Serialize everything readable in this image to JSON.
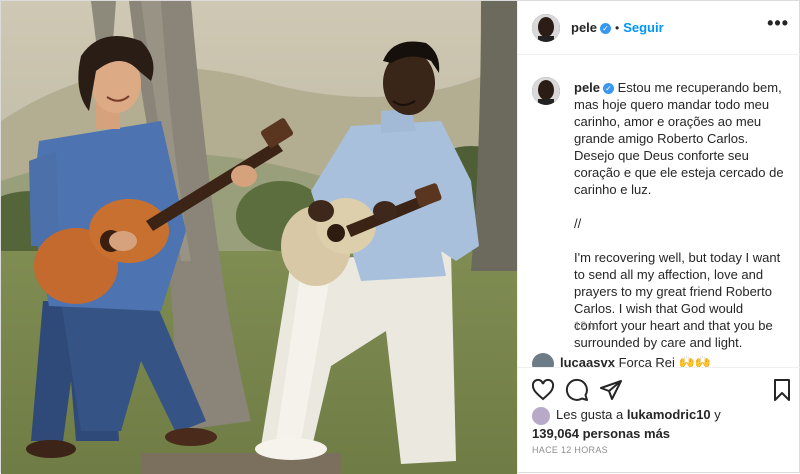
{
  "post": {
    "image_alt": "Pelé and Roberto Carlos playing guitars"
  },
  "header": {
    "username": "pele",
    "verified_mark": "✓",
    "separator": "•",
    "follow_label": "Seguir",
    "more_label": "•••"
  },
  "caption": {
    "username": "pele",
    "verified_mark": "✓",
    "text_pt": "Estou me recuperando bem, mas hoje quero mandar todo meu carinho, amor e orações ao meu grande amigo Roberto Carlos. Desejo que Deus conforte seu coração e que ele esteja cercado de carinho e luz.",
    "divider": "//",
    "text_en": "I'm recovering well, but today I want to send all my affection, love and prayers to my great friend Roberto Carlos. I wish that God would comfort your heart and that you be surrounded by care and light.",
    "time": "12 h"
  },
  "comment": {
    "username": "lucaasvx",
    "text": "Força Rei 🙌🙌"
  },
  "actions": {
    "like_icon": "heart-icon",
    "comment_icon": "comment-icon",
    "share_icon": "share-icon",
    "save_icon": "bookmark-icon"
  },
  "likes": {
    "prefix": "Les gusta a",
    "user": "lukamodric10",
    "joiner": "y",
    "count": "139,064 personas más"
  },
  "posted_ago": "HACE 12 HORAS",
  "colors": {
    "follow": "#0095f6",
    "verified": "#3897f0",
    "muted": "#8e8e8e",
    "text": "#262626"
  }
}
